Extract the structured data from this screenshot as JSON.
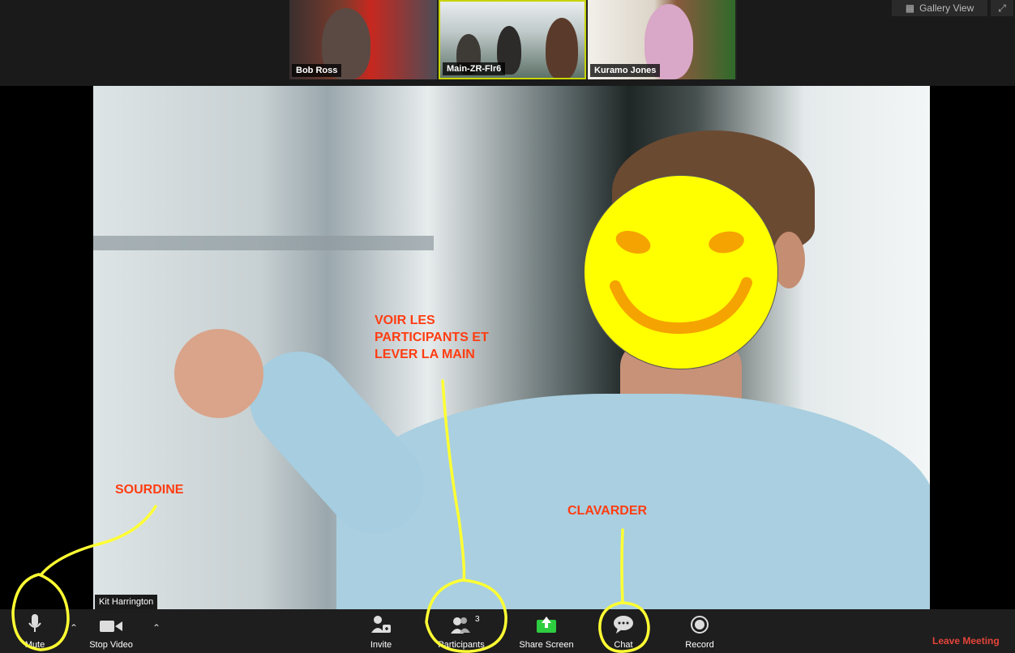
{
  "thumbnails": [
    {
      "name": "Bob Ross"
    },
    {
      "name": "Main-ZR-Flr6"
    },
    {
      "name": "Kuramo Jones"
    }
  ],
  "top_controls": {
    "gallery_view_label": "Gallery View"
  },
  "speaker": {
    "name": "Kit Harrington"
  },
  "toolbar": {
    "mute_label": "Mute",
    "stop_video_label": "Stop Video",
    "invite_label": "Invite",
    "participants_label": "Participants",
    "participants_count": "3",
    "share_screen_label": "Share Screen",
    "chat_label": "Chat",
    "record_label": "Record",
    "leave_label": "Leave Meeting"
  },
  "annotations": {
    "sourdine": "SOURDINE",
    "participants_line1": "VOIR LES",
    "participants_line2": "PARTICIPANTS ET",
    "participants_line3": "LEVER LA MAIN",
    "clavarder": "CLAVARDER"
  },
  "colors": {
    "annotation_text": "#ff3d12",
    "annotation_stroke": "#ffff33",
    "leave_meeting": "#e5443a",
    "share_screen_green": "#2ecc40",
    "smiley_face": "#ffff00",
    "smiley_features": "#f5a300"
  }
}
